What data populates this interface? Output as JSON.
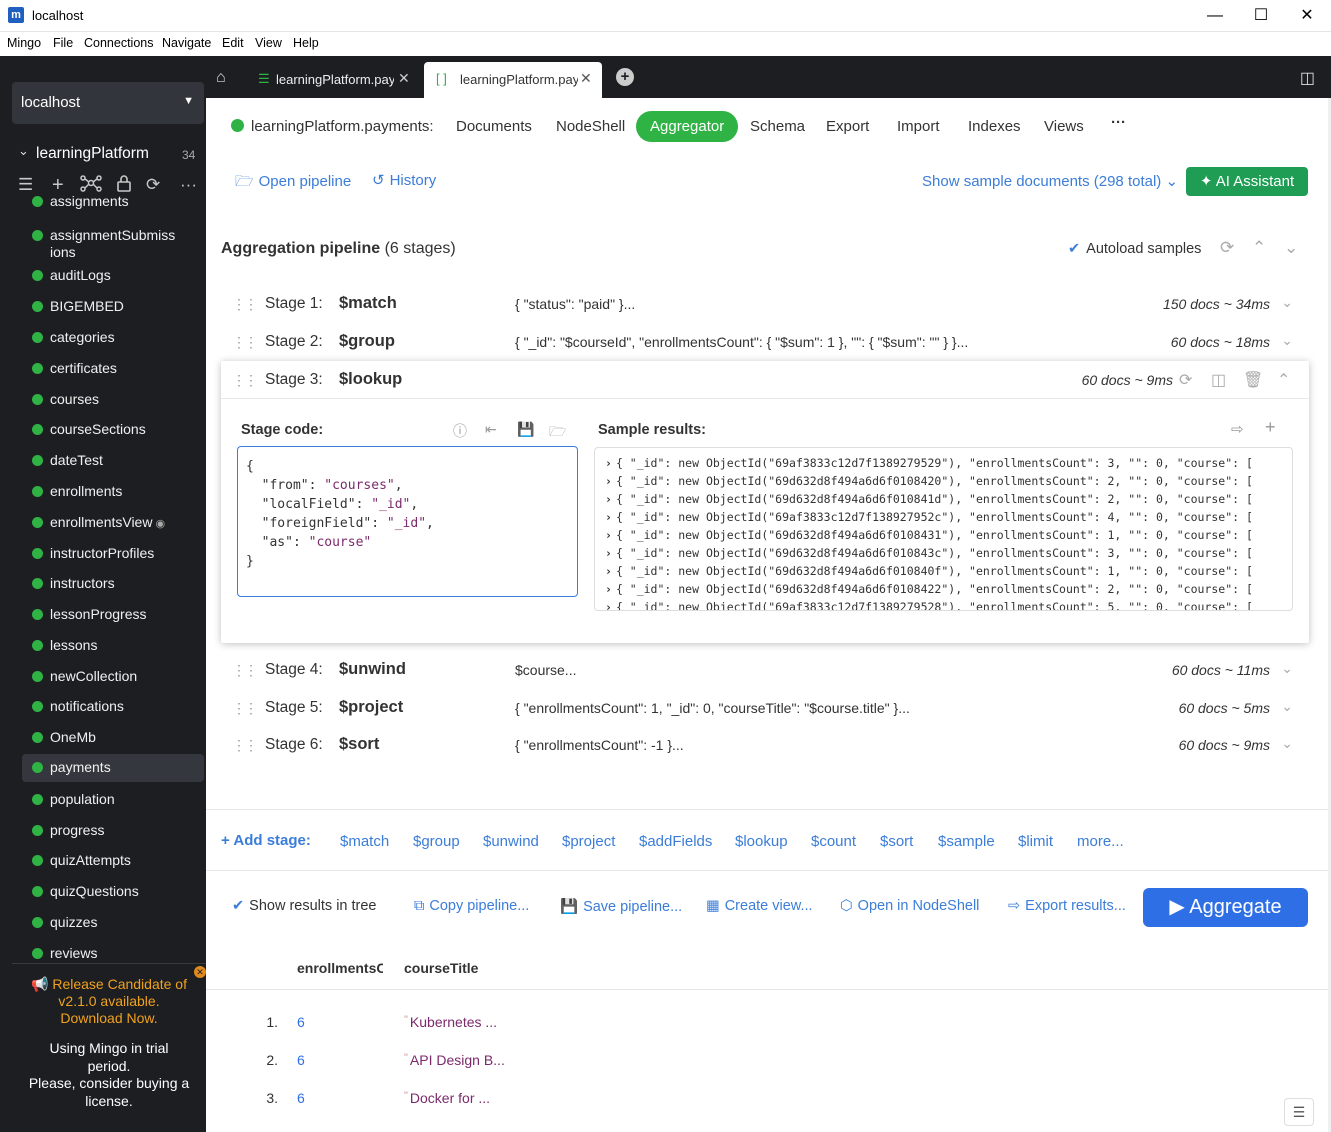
{
  "window": {
    "title": "localhost",
    "app_icon": "m"
  },
  "menubar": [
    "Mingo",
    "File",
    "Connections",
    "Navigate",
    "Edit",
    "View",
    "Help"
  ],
  "sidebar": {
    "connection": "localhost",
    "database": {
      "name": "learningPlatform",
      "count": "34"
    },
    "collections": [
      {
        "name": "assignments"
      },
      {
        "name": "assignmentSubmissions",
        "line1": "assignmentSubmiss",
        "line2": "ions"
      },
      {
        "name": "auditLogs"
      },
      {
        "name": "BIGEMBED"
      },
      {
        "name": "categories"
      },
      {
        "name": "certificates"
      },
      {
        "name": "courses"
      },
      {
        "name": "courseSections"
      },
      {
        "name": "dateTest"
      },
      {
        "name": "enrollments"
      },
      {
        "name": "enrollmentsView",
        "is_view": true
      },
      {
        "name": "instructorProfiles"
      },
      {
        "name": "instructors"
      },
      {
        "name": "lessonProgress"
      },
      {
        "name": "lessons"
      },
      {
        "name": "newCollection"
      },
      {
        "name": "notifications"
      },
      {
        "name": "OneMb"
      },
      {
        "name": "payments",
        "selected": true
      },
      {
        "name": "population"
      },
      {
        "name": "progress"
      },
      {
        "name": "quizAttempts"
      },
      {
        "name": "quizQuestions"
      },
      {
        "name": "quizzes"
      },
      {
        "name": "reviews"
      }
    ],
    "promo": {
      "rc_line1": "Release Candidate of",
      "rc_line2": "v2.1.0 available.",
      "rc_line3": "Download Now.",
      "trial_line1": "Using Mingo in trial",
      "trial_line2": "period.",
      "trial_line3": "Please, consider buying a",
      "trial_line4": "license."
    }
  },
  "tabs": [
    {
      "label": "learningPlatform.payments",
      "active": false
    },
    {
      "label": "learningPlatform.payments",
      "active": true
    }
  ],
  "collection_nav": {
    "path": "learningPlatform.payments:",
    "links": [
      "Documents",
      "NodeShell",
      "Aggregator",
      "Schema",
      "Export",
      "Import",
      "Indexes",
      "Views",
      "···"
    ],
    "active": "Aggregator"
  },
  "toolbar": {
    "open_pipeline": "Open pipeline",
    "history": "History",
    "sample_docs": "Show sample documents (298 total)",
    "ai_assistant": "AI Assistant"
  },
  "pipeline": {
    "title": "Aggregation pipeline",
    "stage_count": "(6 stages)",
    "autoload": "Autoload samples",
    "stages": [
      {
        "num": "Stage 1:",
        "op": "$match",
        "preview": "{ \"status\": \"paid\" }...",
        "stats": "150 docs ~ 34ms"
      },
      {
        "num": "Stage 2:",
        "op": "$group",
        "preview": "{ \"_id\": \"$courseId\", \"enrollmentsCount\": { \"$sum\": 1 }, \"\": { \"$sum\": \"\" } }...",
        "stats": "60 docs ~ 18ms"
      },
      {
        "num": "Stage 3:",
        "op": "$lookup",
        "preview": "",
        "stats": "60 docs ~ 9ms"
      },
      {
        "num": "Stage 4:",
        "op": "$unwind",
        "preview": "$course...",
        "stats": "60 docs ~ 11ms"
      },
      {
        "num": "Stage 5:",
        "op": "$project",
        "preview": "{ \"enrollmentsCount\": 1, \"_id\": 0, \"courseTitle\": \"$course.title\" }...",
        "stats": "60 docs ~ 5ms"
      },
      {
        "num": "Stage 6:",
        "op": "$sort",
        "preview": "{ \"enrollmentsCount\": -1 }...",
        "stats": "60 docs ~ 9ms"
      }
    ],
    "open_stage": {
      "code_label": "Stage code:",
      "results_label": "Sample results:",
      "code": {
        "open": "{",
        "k1": "\"from\"",
        "v1": "\"courses\"",
        "k2": "\"localField\"",
        "v2": "\"_id\"",
        "k3": "\"foreignField\"",
        "v3": "\"_id\"",
        "k4": "\"as\"",
        "v4": "\"course\"",
        "close": "}"
      },
      "results": [
        "{ \"_id\": new ObjectId(\"69af3833c12d7f1389279529\"), \"enrollmentsCount\": 3, \"\": 0, \"course\": [",
        "{ \"_id\": new ObjectId(\"69d632d8f494a6d6f0108420\"), \"enrollmentsCount\": 2, \"\": 0, \"course\": [",
        "{ \"_id\": new ObjectId(\"69d632d8f494a6d6f010841d\"), \"enrollmentsCount\": 2, \"\": 0, \"course\": [",
        "{ \"_id\": new ObjectId(\"69af3833c12d7f138927952c\"), \"enrollmentsCount\": 4, \"\": 0, \"course\": [",
        "{ \"_id\": new ObjectId(\"69d632d8f494a6d6f0108431\"), \"enrollmentsCount\": 1, \"\": 0, \"course\": [",
        "{ \"_id\": new ObjectId(\"69d632d8f494a6d6f010843c\"), \"enrollmentsCount\": 3, \"\": 0, \"course\": [",
        "{ \"_id\": new ObjectId(\"69d632d8f494a6d6f010840f\"), \"enrollmentsCount\": 1, \"\": 0, \"course\": [",
        "{ \"_id\": new ObjectId(\"69d632d8f494a6d6f0108422\"), \"enrollmentsCount\": 2, \"\": 0, \"course\": [",
        "{ \"_id\": new ObjectId(\"69af3833c12d7f1389279528\"), \"enrollmentsCount\": 5, \"\": 0, \"course\": ["
      ]
    }
  },
  "add_stage": {
    "label": "+ Add stage:",
    "ops": [
      "$match",
      "$group",
      "$unwind",
      "$project",
      "$addFields",
      "$lookup",
      "$count",
      "$sort",
      "$sample",
      "$limit",
      "more..."
    ]
  },
  "actions": {
    "show_tree": "Show results in tree",
    "copy": "Copy pipeline...",
    "save": "Save pipeline...",
    "create_view": "Create view...",
    "open_nodeshell": "Open in NodeShell",
    "export": "Export results...",
    "aggregate": "Aggregate"
  },
  "results_table": {
    "columns": [
      "enrollmentsC",
      "courseTitle"
    ],
    "rows": [
      {
        "n": "1.",
        "count": "6",
        "title": "Kubernetes ..."
      },
      {
        "n": "2.",
        "count": "6",
        "title": "API Design B..."
      },
      {
        "n": "3.",
        "count": "6",
        "title": "Docker for ..."
      }
    ]
  },
  "colors": {
    "accent_green": "#2fb344",
    "link_blue": "#3b7dd8",
    "aggregate_blue": "#2f6fe5",
    "sidebar_bg": "#1c1e22"
  }
}
